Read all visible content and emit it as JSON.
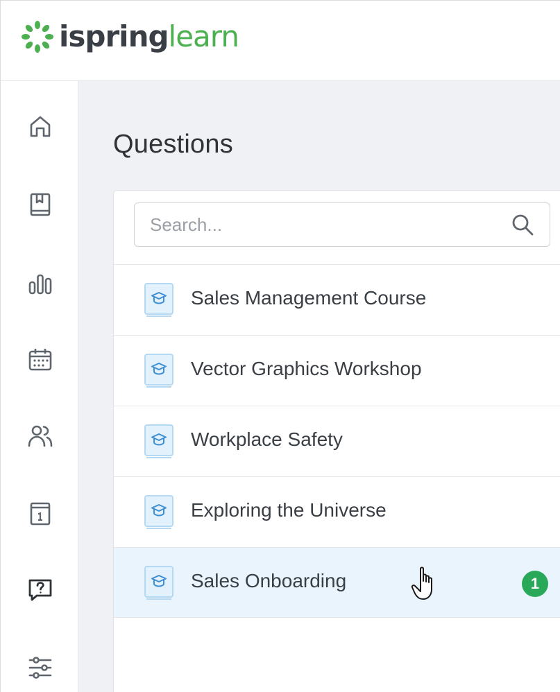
{
  "brand": {
    "part1": "ispring",
    "part2": "learn",
    "primary_color": "#3a3f45",
    "accent_color": "#4caf50"
  },
  "sidebar": {
    "items": [
      {
        "icon": "home-icon"
      },
      {
        "icon": "book-icon"
      },
      {
        "icon": "bar-chart-icon"
      },
      {
        "icon": "calendar-icon"
      },
      {
        "icon": "users-icon"
      },
      {
        "icon": "info-board-icon"
      },
      {
        "icon": "question-icon",
        "active": true
      },
      {
        "icon": "sliders-icon"
      }
    ]
  },
  "main": {
    "title": "Questions",
    "search": {
      "placeholder": "Search...",
      "value": ""
    },
    "courses": [
      {
        "label": "Sales Management Course"
      },
      {
        "label": "Vector Graphics Workshop"
      },
      {
        "label": "Workplace Safety"
      },
      {
        "label": "Exploring the Universe"
      },
      {
        "label": "Sales Onboarding",
        "badge": "1",
        "hovered": true
      }
    ]
  },
  "colors": {
    "badge": "#2aa85a",
    "hover_row": "#e9f4fd",
    "background": "#f0f1f4"
  }
}
